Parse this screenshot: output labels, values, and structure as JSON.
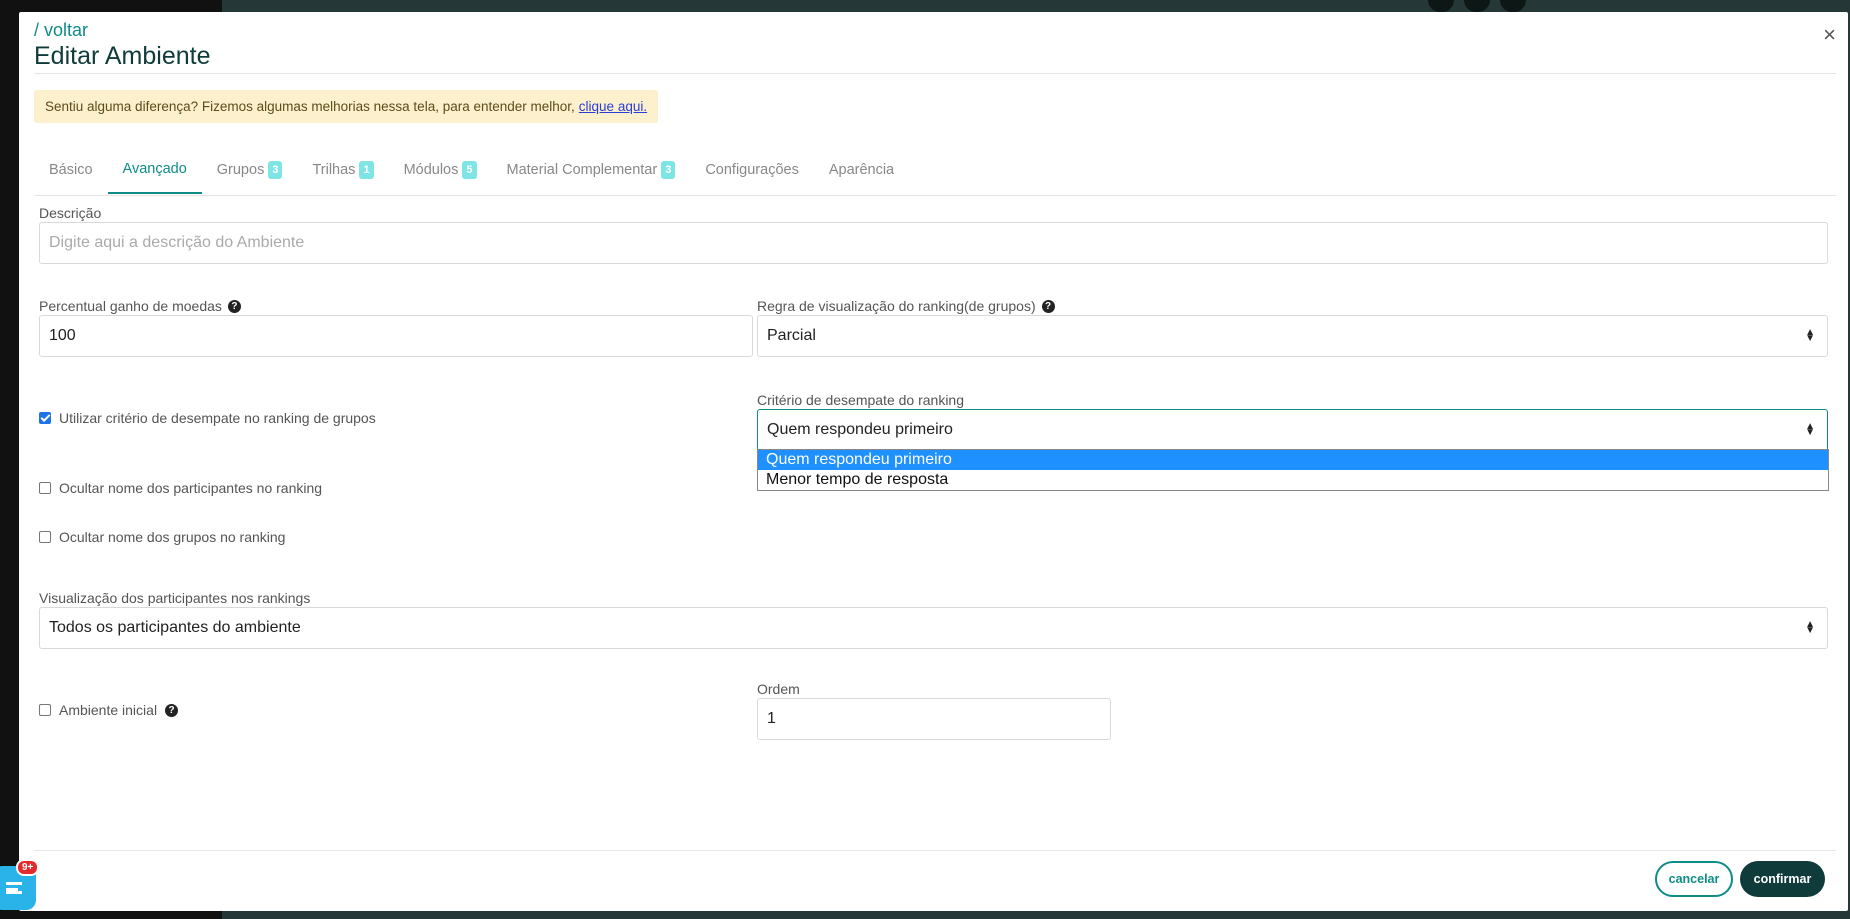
{
  "modal": {
    "back_link": "/ voltar",
    "title": "Editar Ambiente",
    "close": "×"
  },
  "notice": {
    "text": "Sentiu alguma diferença? Fizemos algumas melhorias nessa tela, para entender melhor,",
    "link": "clique aqui."
  },
  "tabs": [
    {
      "label": "Básico",
      "badge": null,
      "active": false
    },
    {
      "label": "Avançado",
      "badge": null,
      "active": true
    },
    {
      "label": "Grupos",
      "badge": "3",
      "active": false
    },
    {
      "label": "Trilhas",
      "badge": "1",
      "active": false
    },
    {
      "label": "Módulos",
      "badge": "5",
      "active": false
    },
    {
      "label": "Material Complementar",
      "badge": "3",
      "active": false
    },
    {
      "label": "Configurações",
      "badge": null,
      "active": false
    },
    {
      "label": "Aparência",
      "badge": null,
      "active": false
    }
  ],
  "form": {
    "descricao": {
      "label": "Descrição",
      "placeholder": "Digite aqui a descrição do Ambiente",
      "value": ""
    },
    "percentual": {
      "label": "Percentual ganho de moedas",
      "value": "100"
    },
    "regra": {
      "label": "Regra de visualização do ranking(de grupos)",
      "value": "Parcial"
    },
    "usar_desempate": {
      "label": "Utilizar critério de desempate no ranking de grupos",
      "checked": true
    },
    "criterio": {
      "label": "Critério de desempate do ranking",
      "value": "Quem respondeu primeiro",
      "options": [
        "Quem respondeu primeiro",
        "Menor tempo de resposta"
      ]
    },
    "ocultar_participantes": {
      "label": "Ocultar nome dos participantes no ranking",
      "checked": false
    },
    "ocultar_grupos": {
      "label": "Ocultar nome dos grupos no ranking",
      "checked": false
    },
    "visualizacao": {
      "label": "Visualização dos participantes nos rankings",
      "value": "Todos os participantes do ambiente"
    },
    "ambiente_inicial": {
      "label": "Ambiente inicial",
      "checked": false
    },
    "ordem": {
      "label": "Ordem",
      "value": "1"
    }
  },
  "footer": {
    "cancel": "cancelar",
    "confirm": "confirmar"
  },
  "chat": {
    "badge": "9+"
  },
  "colors": {
    "accent": "#0e8c88",
    "dark": "#0f3b3a",
    "notice_bg": "#fcf1cc",
    "badge": "#7ee4e4"
  }
}
